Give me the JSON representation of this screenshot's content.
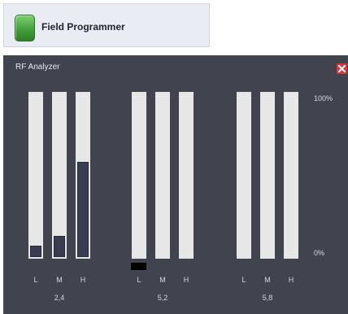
{
  "toolbar": {
    "app_title": "Field Programmer",
    "app_icon": "green-rounded-square-icon"
  },
  "window": {
    "title": "RF Analyzer",
    "close_icon": "close-icon",
    "scale_max": "100%",
    "scale_min": "0%",
    "accent": "#e0353a"
  },
  "chart_data": {
    "type": "bar",
    "ylim": [
      0,
      100
    ],
    "groups": [
      {
        "name": "2,4",
        "bars": [
          {
            "label": "L",
            "value": 7
          },
          {
            "label": "M",
            "value": 13
          },
          {
            "label": "H",
            "value": 58
          }
        ]
      },
      {
        "name": "5,2",
        "bars": [
          {
            "label": "L",
            "value": 0
          },
          {
            "label": "M",
            "value": 0
          },
          {
            "label": "H",
            "value": 0
          }
        ]
      },
      {
        "name": "5,8",
        "bars": [
          {
            "label": "L",
            "value": 0
          },
          {
            "label": "M",
            "value": 0
          },
          {
            "label": "H",
            "value": 0
          }
        ]
      }
    ]
  }
}
